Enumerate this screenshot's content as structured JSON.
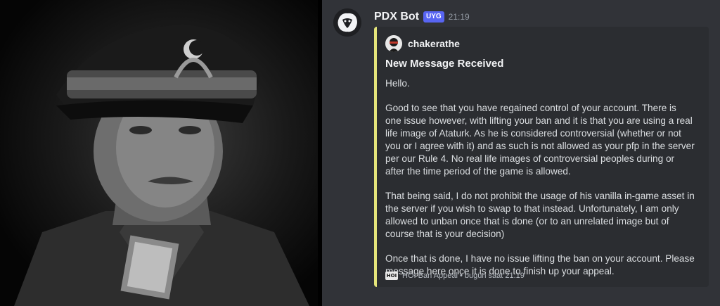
{
  "message": {
    "bot_name": "PDX Bot",
    "app_tag": "UYG",
    "time": "21:19"
  },
  "embed": {
    "author": "chakerathe",
    "title": "New Message Received",
    "paragraphs": [
      "Hello.",
      "Good to see that you have regained control of your account. There is one issue however, with lifting your ban and it is that you are using a real life image of Ataturk. As he is considered controversial (whether or not you or I agree with it) and as such is not allowed as your pfp in the server per our Rule 4. No real life images of controversial peoples during or after the time period of the game is allowed.",
      "That being said, I do not prohibit the usage of his vanilla in-game asset in the server if you wish to swap to that instead. Unfortunately, I am only allowed to unban once that is done (or to an unrelated image but of course that is your decision)",
      "Once that is done, I have no issue lifting the ban on your account. Please message here once it is done to finish up your appeal."
    ],
    "footer": {
      "icon_text": "HOI",
      "text": "HOI Ban Appeal • bugün saat 21:19"
    },
    "accent_color": "#e5e57a"
  },
  "colors": {
    "chat_bg": "#313338",
    "embed_bg": "#2b2d31",
    "tag_bg": "#5865f2"
  },
  "icons": {
    "bot_avatar": "pdx-lion-icon",
    "author_avatar": "author-avatar-icon",
    "footer_icon": "hoi-icon"
  }
}
